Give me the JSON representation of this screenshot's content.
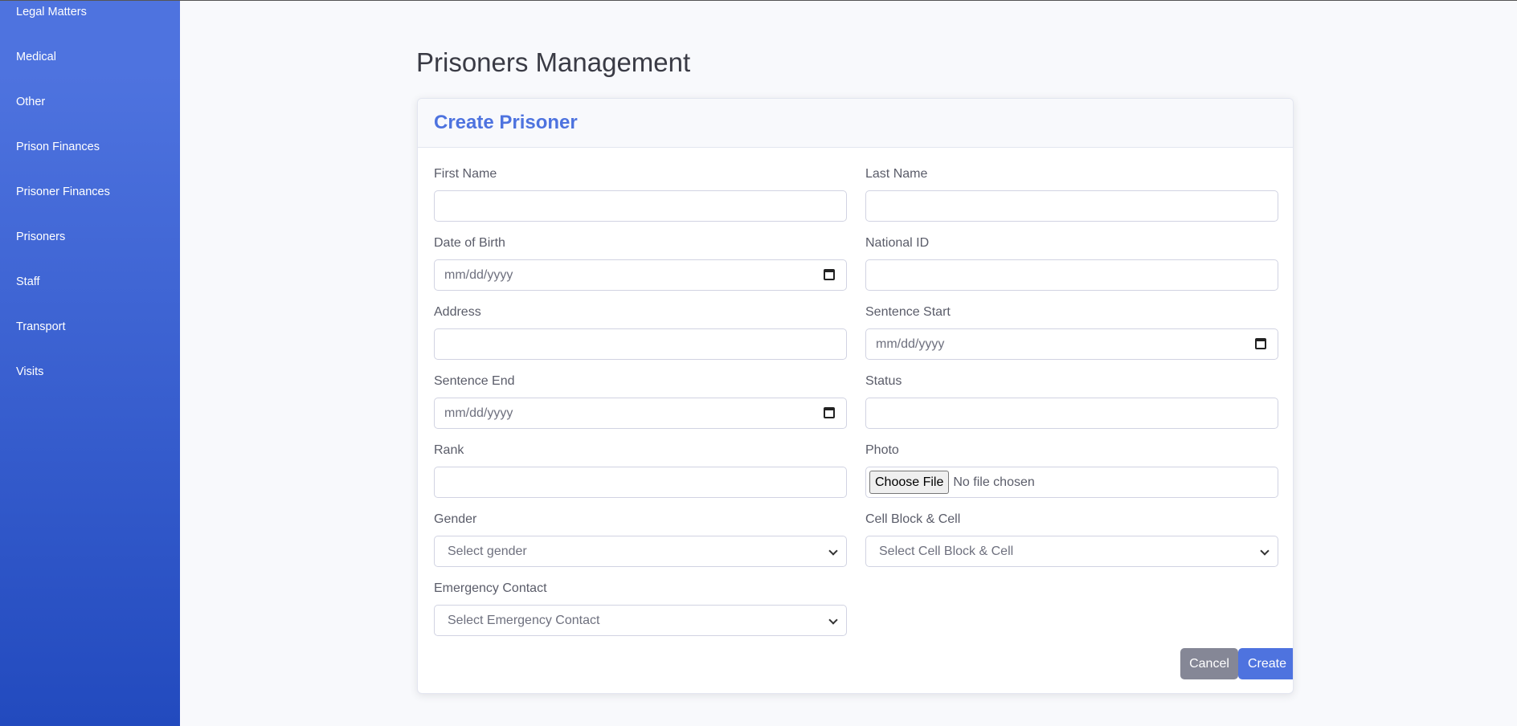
{
  "sidebar": {
    "items": [
      {
        "label": "Legal Matters"
      },
      {
        "label": "Medical"
      },
      {
        "label": "Other"
      },
      {
        "label": "Prison Finances"
      },
      {
        "label": "Prisoner Finances"
      },
      {
        "label": "Prisoners"
      },
      {
        "label": "Staff"
      },
      {
        "label": "Transport"
      },
      {
        "label": "Visits"
      }
    ]
  },
  "page_title": "Prisoners Management",
  "card_title": "Create Prisoner",
  "form": {
    "first_name": {
      "label": "First Name",
      "value": ""
    },
    "last_name": {
      "label": "Last Name",
      "value": ""
    },
    "dob": {
      "label": "Date of Birth",
      "placeholder": "mm/dd/yyyy"
    },
    "national_id": {
      "label": "National ID",
      "value": ""
    },
    "address": {
      "label": "Address",
      "value": ""
    },
    "sentence_start": {
      "label": "Sentence Start",
      "placeholder": "mm/dd/yyyy"
    },
    "sentence_end": {
      "label": "Sentence End",
      "placeholder": "mm/dd/yyyy"
    },
    "status": {
      "label": "Status",
      "value": ""
    },
    "rank": {
      "label": "Rank",
      "value": ""
    },
    "photo": {
      "label": "Photo",
      "button": "Choose File",
      "text": "No file chosen"
    },
    "gender": {
      "label": "Gender",
      "selected": "Select gender"
    },
    "cell": {
      "label": "Cell Block & Cell",
      "selected": "Select Cell Block & Cell"
    },
    "emergency": {
      "label": "Emergency Contact",
      "selected": "Select Emergency Contact"
    }
  },
  "buttons": {
    "cancel": "Cancel",
    "create": "Create"
  },
  "colors": {
    "primary": "#4e73df",
    "secondary": "#858796",
    "sidebar_end": "#224abe"
  }
}
